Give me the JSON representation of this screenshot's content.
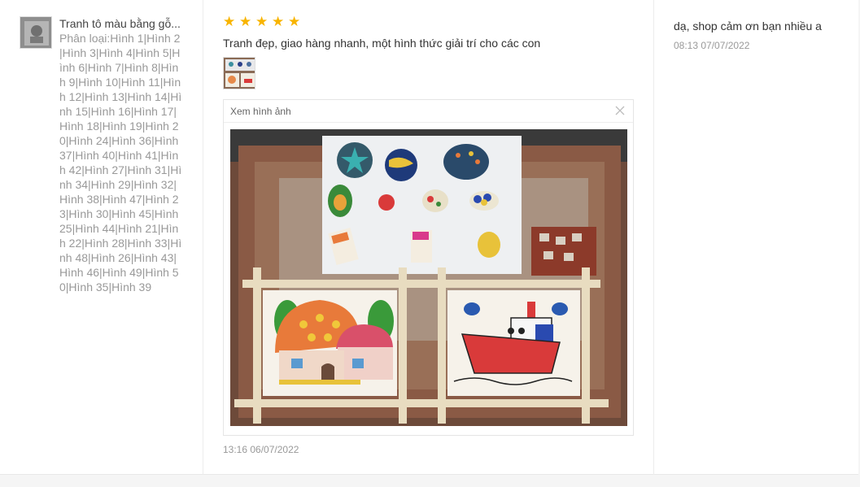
{
  "product": {
    "name": "Tranh tô màu bằng gỗ...",
    "variant": "Phân loại:Hình 1|Hình 2|Hình 3|Hình 4|Hình 5|Hình 6|Hình 7|Hình 8|Hình 9|Hình 10|Hình 11|Hình 12|Hình 13|Hình 14|Hình 15|Hình 16|Hình 17|Hình 18|Hình 19|Hình 20|Hình 24|Hình 36|Hình 37|Hình 40|Hình 41|Hình 42|Hình 27|Hình 31|Hình 34|Hình 29|Hình 32|Hình 38|Hình 47|Hình 23|Hình 30|Hình 45|Hình 25|Hình 44|Hình 21|Hình 22|Hình 28|Hình 33|Hình 48|Hình 26|Hình 43|Hình 46|Hình 49|Hình 50|Hình 35|Hình 39"
  },
  "review": {
    "rating": 5,
    "stars": [
      "★",
      "★",
      "★",
      "★",
      "★"
    ],
    "text": "Tranh đẹp, giao hàng nhanh, một hình thức giải trí cho các con",
    "time": "13:16 06/07/2022"
  },
  "viewer": {
    "title": "Xem hình ảnh",
    "close_icon": "close-icon"
  },
  "reply": {
    "text": "dạ, shop cảm ơn bạn nhiều a",
    "time": "08:13 07/07/2022"
  },
  "colors": {
    "star": "#f8b400",
    "muted": "#999999",
    "text": "#333333"
  }
}
